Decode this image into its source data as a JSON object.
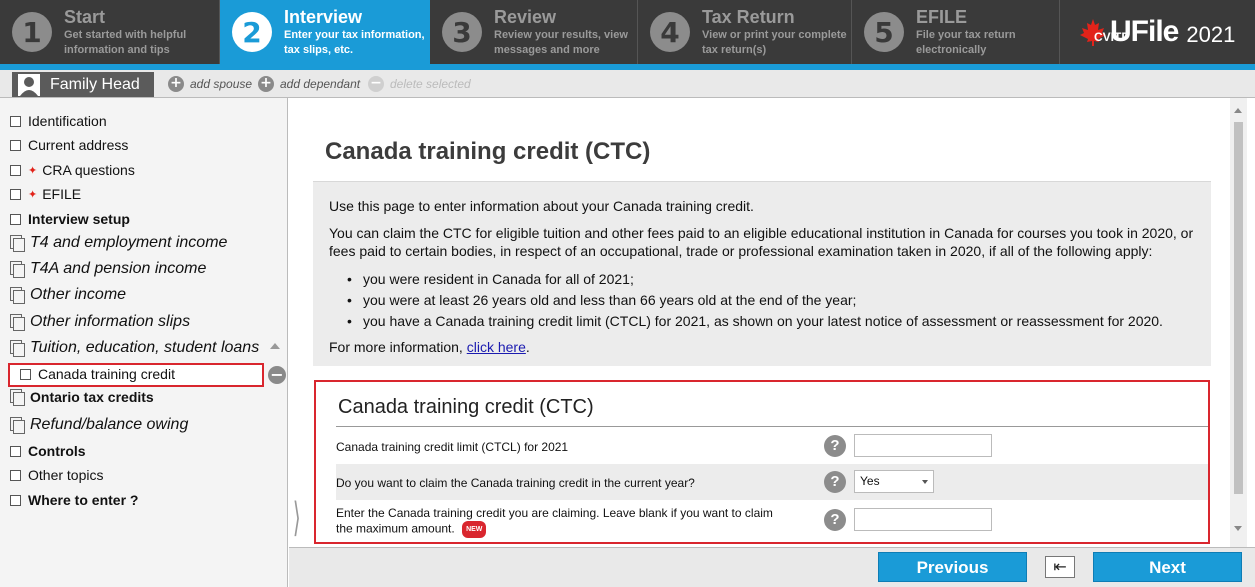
{
  "steps": [
    {
      "num": "1",
      "title": "Start",
      "sub1": "Get started with helpful",
      "sub2": "information and tips"
    },
    {
      "num": "2",
      "title": "Interview",
      "sub1": "Enter your tax information,",
      "sub2": "tax slips, etc."
    },
    {
      "num": "3",
      "title": "Review",
      "sub1": "Review your results, view",
      "sub2": "messages and more"
    },
    {
      "num": "4",
      "title": "Tax Return",
      "sub1": "View or print your complete",
      "sub2": "tax return(s)"
    },
    {
      "num": "5",
      "title": "EFILE",
      "sub1": "File your tax return",
      "sub2": "electronically"
    }
  ],
  "logo": {
    "brand": "UFile",
    "sub": "CVITP",
    "year": "2021"
  },
  "personbar": {
    "family_head": "Family Head",
    "add_spouse": "add spouse",
    "add_dependant": "add dependant",
    "delete_selected": "delete selected"
  },
  "sidebar": {
    "items": [
      {
        "label": "Identification"
      },
      {
        "label": "Current address"
      },
      {
        "label": "CRA questions"
      },
      {
        "label": "EFILE"
      },
      {
        "label": "Interview setup"
      },
      {
        "label": "T4 and employment income"
      },
      {
        "label": "T4A and pension income"
      },
      {
        "label": "Other income"
      },
      {
        "label": "Other information slips"
      },
      {
        "label": "Tuition, education, student loans"
      },
      {
        "label": "Canada training credit"
      },
      {
        "label": "Ontario tax credits"
      },
      {
        "label": "Refund/balance owing"
      },
      {
        "label": "Controls"
      },
      {
        "label": "Other topics"
      },
      {
        "label": "Where to enter ?"
      }
    ]
  },
  "main": {
    "title": "Canada training credit (CTC)",
    "intro": "Use this page to enter information about your Canada training credit.",
    "para": "You can claim the CTC for eligible tuition and other fees paid to an eligible educational institution in Canada for courses you took in 2020, or fees paid to certain bodies, in respect of an occupational, trade or professional examination taken in 2020, if all of the following apply:",
    "bullets": [
      "you were resident in Canada for all of 2021;",
      "you were at least 26 years old and less than 66 years old at the end of the year;",
      "you have a Canada training credit limit (CTCL) for 2021, as shown on your latest notice of assessment or reassessment for 2020."
    ],
    "more_info": "For more information,",
    "click_here": "click here",
    "more_info_end": "."
  },
  "form": {
    "title": "Canada training credit (CTC)",
    "rows": [
      {
        "label": "Canada training credit limit (CTCL) for 2021",
        "value": ""
      },
      {
        "label": "Do you want to claim the Canada training credit in the current year?",
        "value": "Yes"
      },
      {
        "label1": "Enter the Canada training credit you are claiming. Leave blank if you want to claim",
        "label2": "the maximum amount.",
        "badge": "NEW",
        "value": ""
      }
    ],
    "help": "?"
  },
  "nav": {
    "previous": "Previous",
    "next": "Next"
  },
  "colors": {
    "accent": "#1a9bd7",
    "highlight": "#d9262e",
    "topbar": "#3a3a3a"
  }
}
